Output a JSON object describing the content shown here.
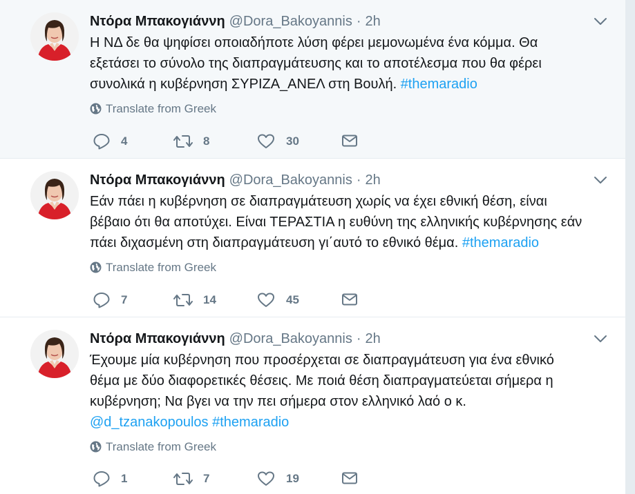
{
  "tweets": [
    {
      "fullname": "Ντόρα Μπακογιάννη",
      "username": "@Dora_Bakoyannis",
      "separator": "·",
      "time": "2h",
      "text_lines": [
        "Η ΝΔ δε θα ψηφίσει οποιαδήποτε λύση φέρει μεμονωμένα ένα κόμμα. Θα",
        "εξετάσει το σύνολο της διαπραγμάτευσης και το αποτέλεσμα που θα φέρει",
        "συνολικά η κυβέρνηση ΣΥΡΙΖΑ_ΑΝΕΛ στη Βουλή. "
      ],
      "hashtag": "#themaradio",
      "translate_label": "Translate from Greek",
      "replies": "4",
      "retweets": "8",
      "likes": "30"
    },
    {
      "fullname": "Ντόρα Μπακογιάννη",
      "username": "@Dora_Bakoyannis",
      "separator": "·",
      "time": "2h",
      "text_lines": [
        "Εάν πάει η κυβέρνηση σε διαπραγμάτευση χωρίς να έχει εθνική θέση, είναι",
        "βέβαιο ότι θα αποτύχει. Είναι ΤΕΡΑΣΤΙΑ η ευθύνη της ελληνικής κυβέρνησης εάν",
        "πάει διχασμένη στη διαπραγμάτευση γι΄αυτό το εθνικό θέμα. "
      ],
      "hashtag": "#themaradio",
      "translate_label": "Translate from Greek",
      "replies": "7",
      "retweets": "14",
      "likes": "45"
    },
    {
      "fullname": "Ντόρα Μπακογιάννη",
      "username": "@Dora_Bakoyannis",
      "separator": "·",
      "time": "2h",
      "text_lines": [
        "Έχουμε μία κυβέρνηση που προσέρχεται σε διαπραγμάτευση για ένα εθνικό",
        "θέμα με δύο διαφορετικές θέσεις. Με ποιά θέση διαπραγματεύεται σήμερα η",
        "κυβέρνηση; Να βγει να την πει σήμερα στον ελληνικό λαό ο κ."
      ],
      "mention": "@d_tzanakopoulos",
      "hashtag": "#themaradio",
      "translate_label": "Translate from Greek",
      "replies": "1",
      "retweets": "7",
      "likes": "19"
    }
  ],
  "colors": {
    "link": "#1da1f2",
    "secondary_text": "#657786",
    "primary_text": "#14171a",
    "highlight_background": "#f5f8fa",
    "border": "#e6ecf0",
    "avatar_jacket": "#d8202a"
  }
}
